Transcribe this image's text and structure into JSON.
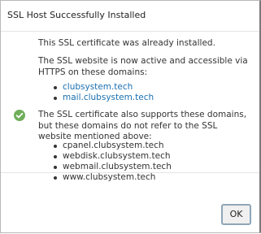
{
  "dialog": {
    "title": "SSL Host Successfully Installed",
    "status_icon": "check-circle-icon",
    "already_installed_text": "This SSL certificate was already installed.",
    "active_text": "The SSL website is now active and accessible via HTTPS on these domains:",
    "ssl_domains": [
      "clubsystem.tech",
      "mail.clubsystem.tech"
    ],
    "other_domains_text": "The SSL certificate also supports these domains, but these domains do not refer to the SSL website mentioned above:",
    "other_domains": [
      "cpanel.clubsystem.tech",
      "webdisk.clubsystem.tech",
      "webmail.clubsystem.tech",
      "www.clubsystem.tech"
    ],
    "ok_label": "OK"
  },
  "colors": {
    "link": "#1a6fb0",
    "success": "#6fae5a",
    "button_border": "#8ea6b8"
  }
}
